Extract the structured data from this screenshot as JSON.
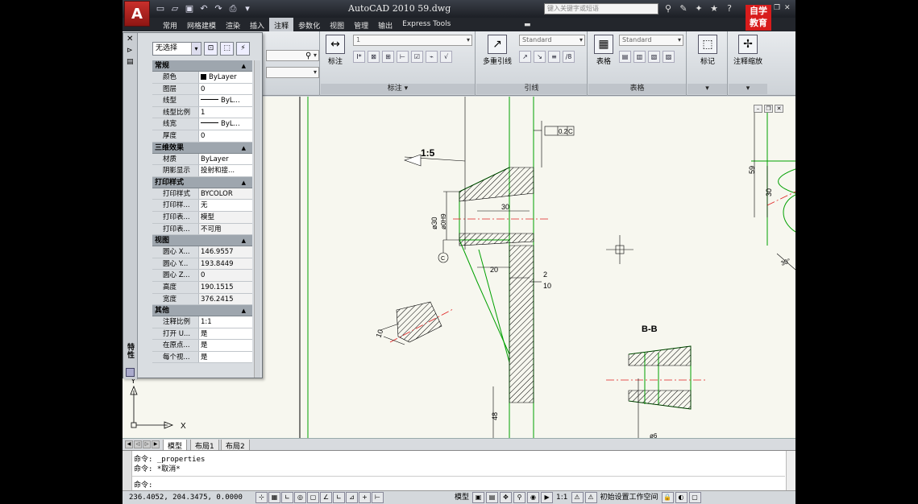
{
  "app": {
    "title": "AutoCAD 2010   59.dwg",
    "search_placeholder": "键入关键字或短语",
    "brand_lines": [
      "自",
      "学",
      "教",
      "育"
    ],
    "logo": "A"
  },
  "ribbon_tabs": [
    "常用",
    "网格建模",
    "渲染",
    "插入",
    "注释",
    "参数化",
    "视图",
    "管理",
    "输出",
    "Express Tools"
  ],
  "active_tab": "注释",
  "ribbon": {
    "dimension": {
      "big_label": "标注",
      "style_value": "1",
      "group_label": "标注 ▾"
    },
    "leader": {
      "big_label": "多重引线",
      "style_value": "Standard",
      "group_label": "引线"
    },
    "table": {
      "big_label": "表格",
      "style_value": "Standard",
      "group_label": "表格"
    },
    "mark": {
      "big_label": "标记"
    },
    "scale": {
      "big_label": "注释缩放"
    }
  },
  "properties": {
    "selection": "无选择",
    "vertical_label": "特性",
    "categories": [
      {
        "name": "常规",
        "rows": [
          {
            "k": "颜色",
            "v": "ByLayer",
            "kind": "swatch"
          },
          {
            "k": "图层",
            "v": "0"
          },
          {
            "k": "线型",
            "v": "ByL...",
            "kind": "line"
          },
          {
            "k": "线型比例",
            "v": "1"
          },
          {
            "k": "线宽",
            "v": "ByL...",
            "kind": "line"
          },
          {
            "k": "厚度",
            "v": "0"
          }
        ]
      },
      {
        "name": "三维效果",
        "rows": [
          {
            "k": "材质",
            "v": "ByLayer"
          },
          {
            "k": "阴影显示",
            "v": "投射和接..."
          }
        ]
      },
      {
        "name": "打印样式",
        "rows": [
          {
            "k": "打印样式",
            "v": "BYCOLOR",
            "ro": true
          },
          {
            "k": "打印样...",
            "v": "无"
          },
          {
            "k": "打印表...",
            "v": "模型",
            "ro": true
          },
          {
            "k": "打印表...",
            "v": "不可用",
            "ro": true
          }
        ]
      },
      {
        "name": "视图",
        "rows": [
          {
            "k": "圆心 X...",
            "v": "146.9557",
            "ro": true
          },
          {
            "k": "圆心 Y...",
            "v": "193.8449",
            "ro": true
          },
          {
            "k": "圆心 Z...",
            "v": "0",
            "ro": true
          },
          {
            "k": "高度",
            "v": "190.1515",
            "ro": true
          },
          {
            "k": "宽度",
            "v": "376.2415",
            "ro": true
          }
        ]
      },
      {
        "name": "其他",
        "rows": [
          {
            "k": "注释比例",
            "v": "1:1"
          },
          {
            "k": "打开 U...",
            "v": "是"
          },
          {
            "k": "在原点...",
            "v": "是"
          },
          {
            "k": "每个视...",
            "v": "是"
          }
        ]
      }
    ]
  },
  "drawing": {
    "scale_label": "1:5",
    "section_label": "B-B",
    "tolerance_value": "0.2",
    "tolerance_ref": "C",
    "datum_label": "C",
    "dims": {
      "d30": "30",
      "d20": "20",
      "d2": "2",
      "d10": "10",
      "d48": "48",
      "d59": "59",
      "d30v": "30",
      "dia30": "ø30",
      "dia6": "ø6",
      "dia0": "ø0H9",
      "d30r": "30°",
      "d10l": "10"
    },
    "ucs_x": "X",
    "ucs_y": "Y"
  },
  "layout_tabs": [
    "模型",
    "布局1",
    "布局2"
  ],
  "command": {
    "line1": "命令: _properties",
    "line2": "命令: *取消*",
    "prompt": "命令:"
  },
  "status": {
    "coords": "236.4052, 204.3475, 0.0000",
    "model": "模型",
    "scale": "1:1",
    "workspace": "初始设置工作空间"
  }
}
